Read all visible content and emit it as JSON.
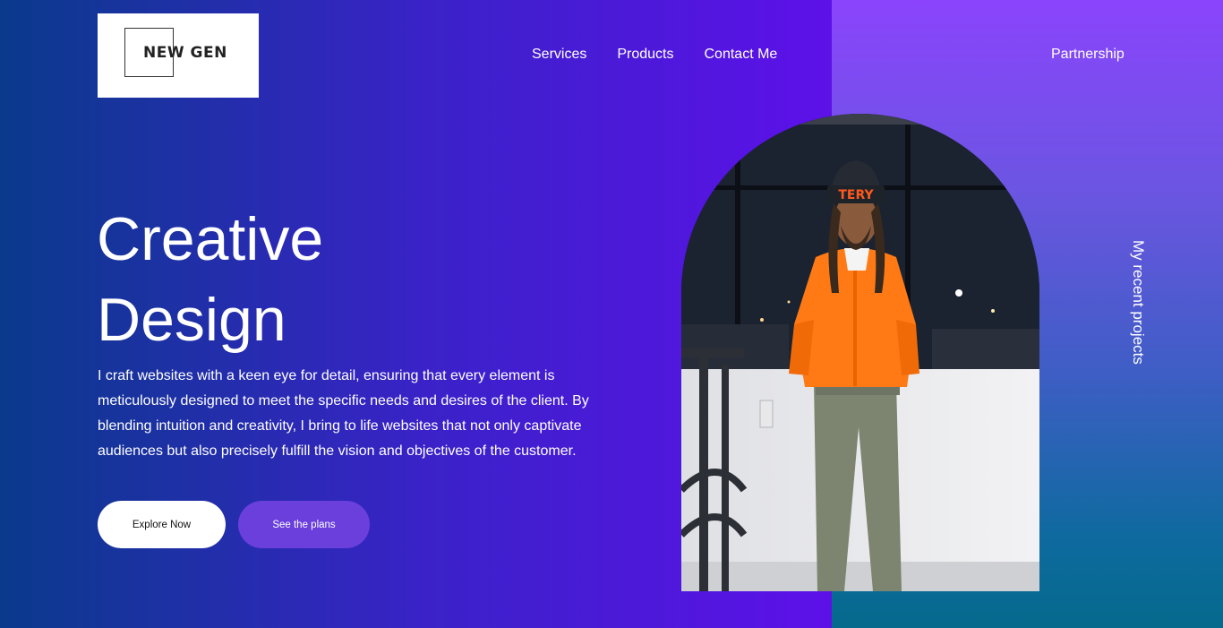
{
  "logo": {
    "text": "NEW GEN"
  },
  "nav": {
    "items": [
      {
        "label": "Services"
      },
      {
        "label": "Products"
      },
      {
        "label": "Contact Me"
      }
    ],
    "partnership": "Partnership"
  },
  "hero": {
    "title_line1": "Creative",
    "title_line2": "Design",
    "description": "I craft websites with a keen eye for detail, ensuring that every element is meticulously designed to meet the specific needs and desires of the client. By blending intuition and creativity, I bring to life websites that not only captivate audiences but also precisely fulfill the vision and objectives of the customer.",
    "primary_button": "Explore Now",
    "secondary_button": "See the plans"
  },
  "side": {
    "vertical_link": "My recent projects"
  },
  "photo": {
    "hat_text": "TERY"
  },
  "colors": {
    "accent_button": "#6a3fdc",
    "jacket": "#ff7a14",
    "gradient_left": "#0a3a8c",
    "gradient_right": "#7a06f2"
  }
}
